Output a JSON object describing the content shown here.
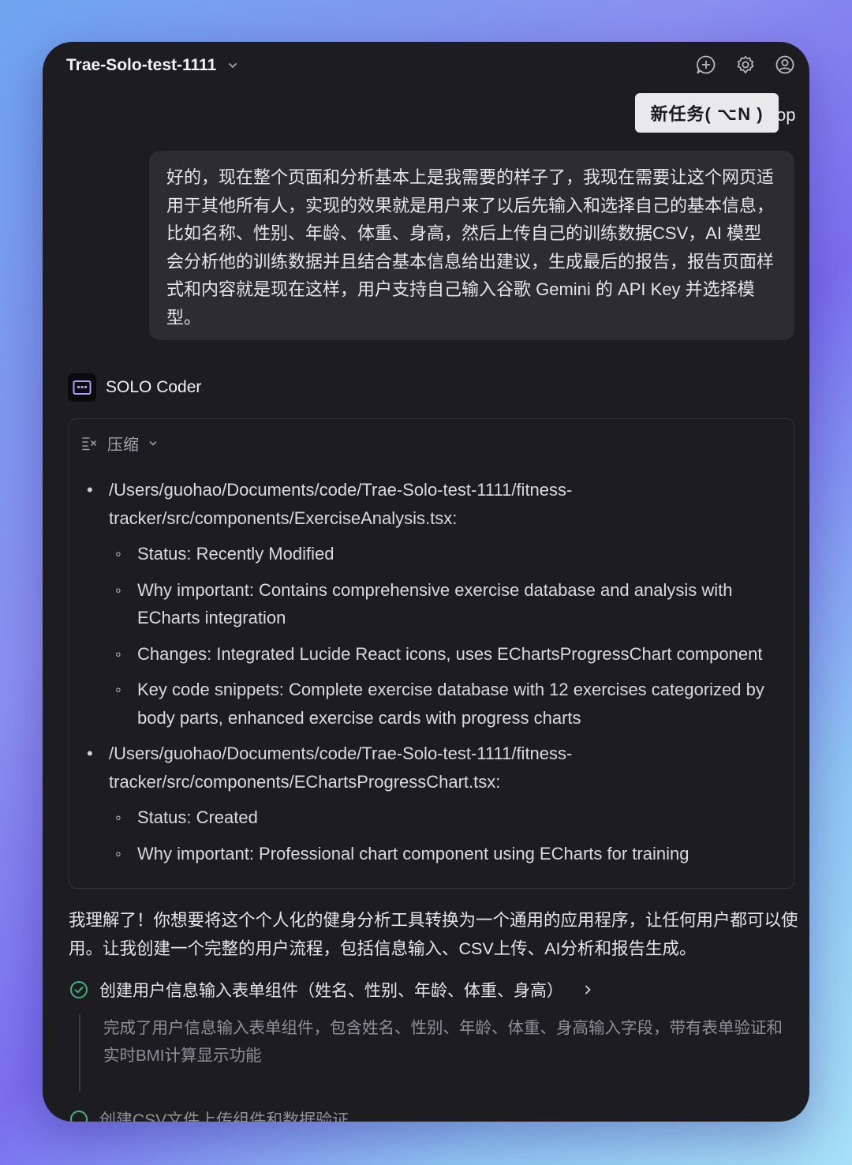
{
  "header": {
    "title": "Trae-Solo-test-1111",
    "tooltip": "新任务( ⌥N )",
    "tooltip_overflow": "op"
  },
  "user_message": "好的，现在整个页面和分析基本上是我需要的样子了，我现在需要让这个网页适用于其他所有人，实现的效果就是用户来了以后先输入和选择自己的基本信息，比如名称、性别、年龄、体重、身高，然后上传自己的训练数据CSV，AI 模型会分析他的训练数据并且结合基本信息给出建议，生成最后的报告，报告页面样式和内容就是现在这样，用户支持自己输入谷歌 Gemini 的 API Key 并选择模型。",
  "agent": {
    "name": "SOLO Coder"
  },
  "summary_card": {
    "header_label": "压缩",
    "items": [
      {
        "path": "/Users/guohao/Documents/code/Trae-Solo-test-1111/fitness-tracker/src/components/ExerciseAnalysis.tsx:",
        "subs": [
          "Status: Recently Modified",
          "Why important: Contains comprehensive exercise database and analysis with ECharts integration",
          "Changes: Integrated Lucide React icons, uses EChartsProgressChart component",
          "Key code snippets: Complete exercise database with 12 exercises categorized by body parts, enhanced exercise cards with progress charts"
        ]
      },
      {
        "path": "/Users/guohao/Documents/code/Trae-Solo-test-1111/fitness-tracker/src/components/EChartsProgressChart.tsx:",
        "subs": [
          "Status: Created",
          "Why important: Professional chart component using ECharts for training"
        ]
      }
    ]
  },
  "reply_text": "我理解了！你想要将这个个人化的健身分析工具转换为一个通用的应用程序，让任何用户都可以使用。让我创建一个完整的用户流程，包括信息输入、CSV上传、AI分析和报告生成。",
  "tasks": [
    {
      "title": "创建用户信息输入表单组件（姓名、性别、年龄、体重、身高）",
      "status": "done",
      "detail": "完成了用户信息输入表单组件，包含姓名、性别、年龄、体重、身高输入字段，带有表单验证和实时BMI计算显示功能"
    },
    {
      "title": "创建CSV文件上传组件和数据验证",
      "status": "pending"
    }
  ],
  "colors": {
    "accent_check": "#3fb37f",
    "agent_badge": "#a78bfa"
  }
}
